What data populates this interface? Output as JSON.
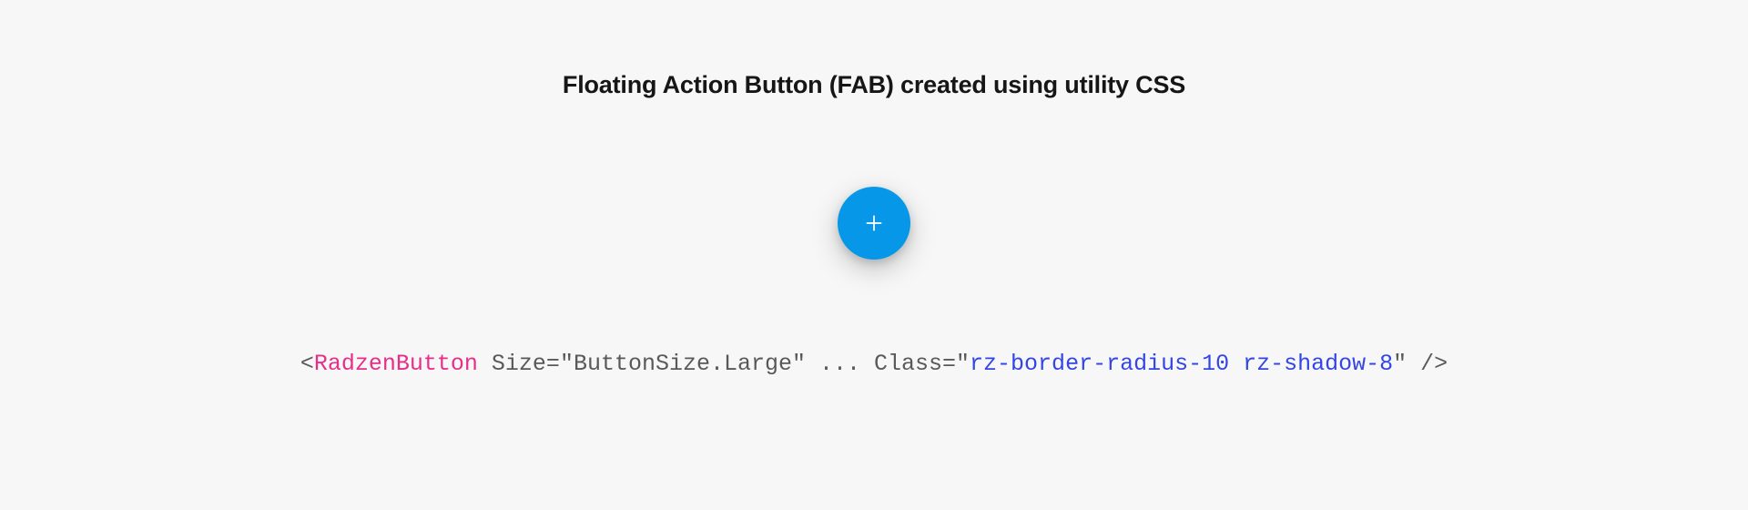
{
  "heading": "Floating Action Button (FAB) created using utility CSS",
  "fab": {
    "icon_name": "add-icon",
    "accent_color": "#0797e8"
  },
  "code": {
    "lt": "<",
    "tag": "RadzenButton",
    "sp1": " ",
    "attr1_name": "Size",
    "eq1": "=",
    "attr1_val": "\"ButtonSize.Large\"",
    "ellipsis": " ... ",
    "attr2_name": "Class",
    "eq2": "=",
    "q_open": "\"",
    "classvalue": "rz-border-radius-10 rz-shadow-8",
    "q_close": "\"",
    "close": " />"
  }
}
